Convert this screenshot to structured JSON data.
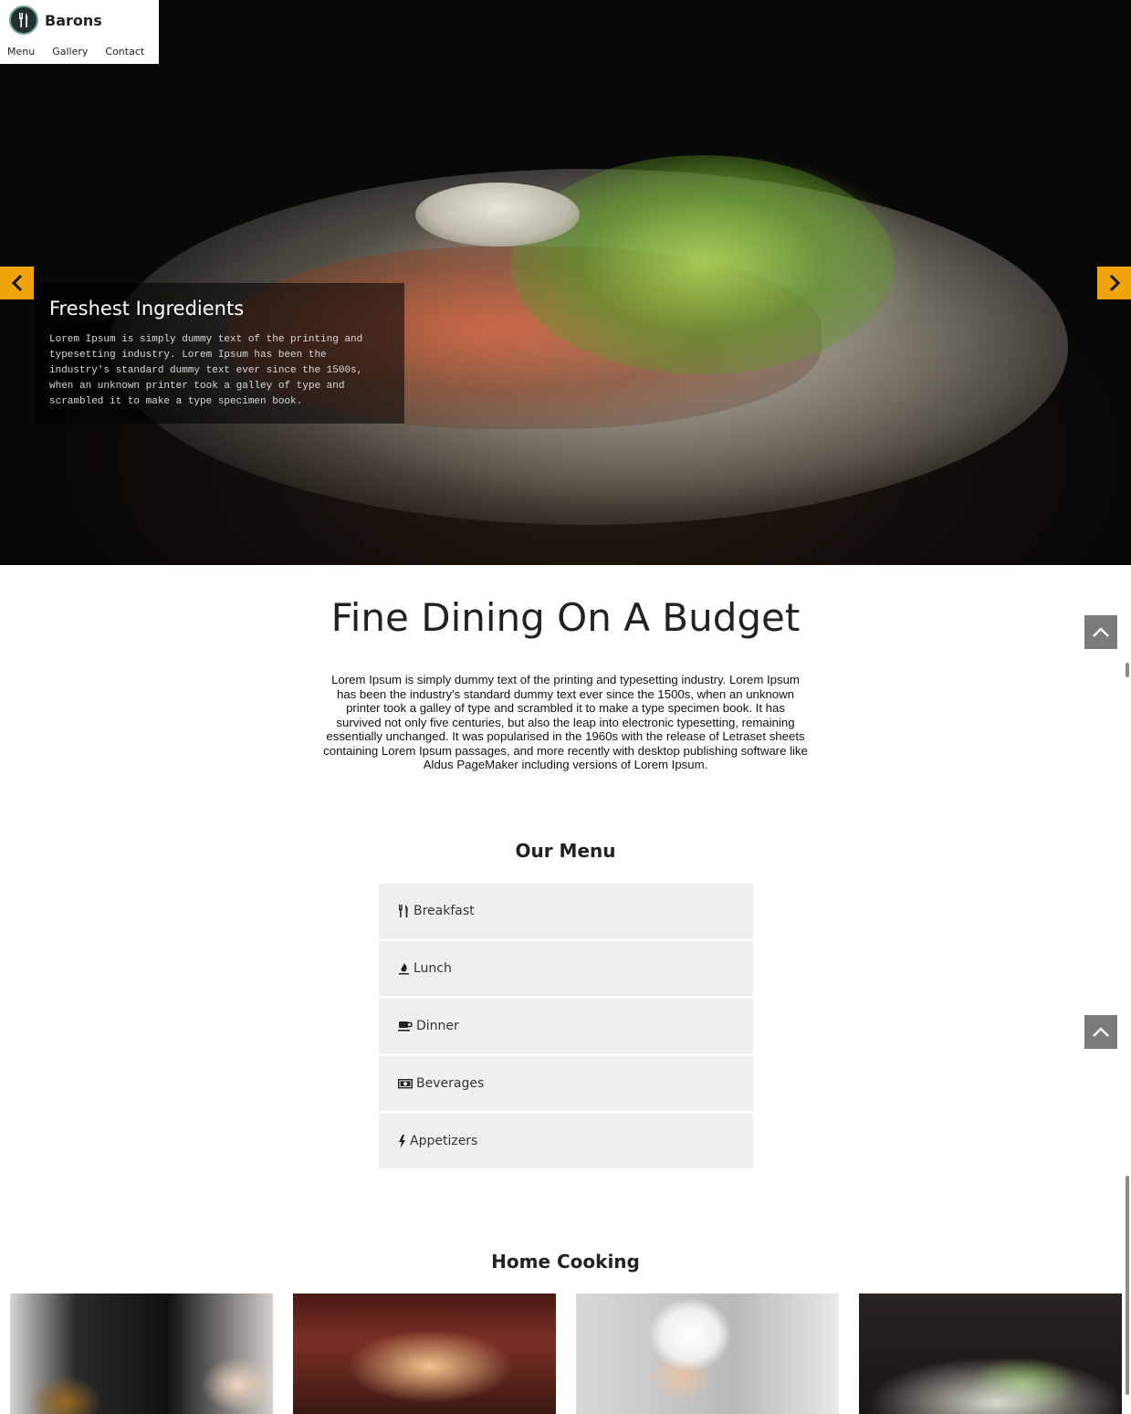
{
  "brand": {
    "name": "Barons"
  },
  "nav": {
    "items": [
      "Menu",
      "Gallery",
      "Contact"
    ]
  },
  "hero": {
    "caption_title": "Freshest Ingredients",
    "caption_text": "Lorem Ipsum is simply dummy text of the printing and typesetting industry. Lorem Ipsum has been the industry's standard dummy text ever since the 1500s, when an unknown printer took a galley of type and scrambled it to make a type specimen book."
  },
  "intro": {
    "title": "Fine Dining On A Budget",
    "text": "Lorem Ipsum is simply dummy text of the printing and typesetting industry. Lorem Ipsum has been the industry's standard dummy text ever since the 1500s, when an unknown printer took a galley of type and scrambled it to make a type specimen book. It has survived not only five centuries, but also the leap into electronic typesetting, remaining essentially unchanged. It was popularised in the 1960s with the release of Letraset sheets containing Lorem Ipsum passages, and more recently with desktop publishing software like Aldus PageMaker including versions of Lorem Ipsum."
  },
  "menu": {
    "heading": "Our Menu",
    "items": [
      {
        "label": "Breakfast",
        "icon": "cutlery-icon"
      },
      {
        "label": "Lunch",
        "icon": "fire-icon"
      },
      {
        "label": "Dinner",
        "icon": "coffee-icon"
      },
      {
        "label": "Beverages",
        "icon": "money-icon"
      },
      {
        "label": "Appetizers",
        "icon": "bolt-icon"
      }
    ]
  },
  "gallery": {
    "heading": "Home Cooking"
  },
  "colors": {
    "accent": "#f0a30a",
    "tile_bg": "#efefef",
    "to_top_bg": "#7b7b7b"
  }
}
